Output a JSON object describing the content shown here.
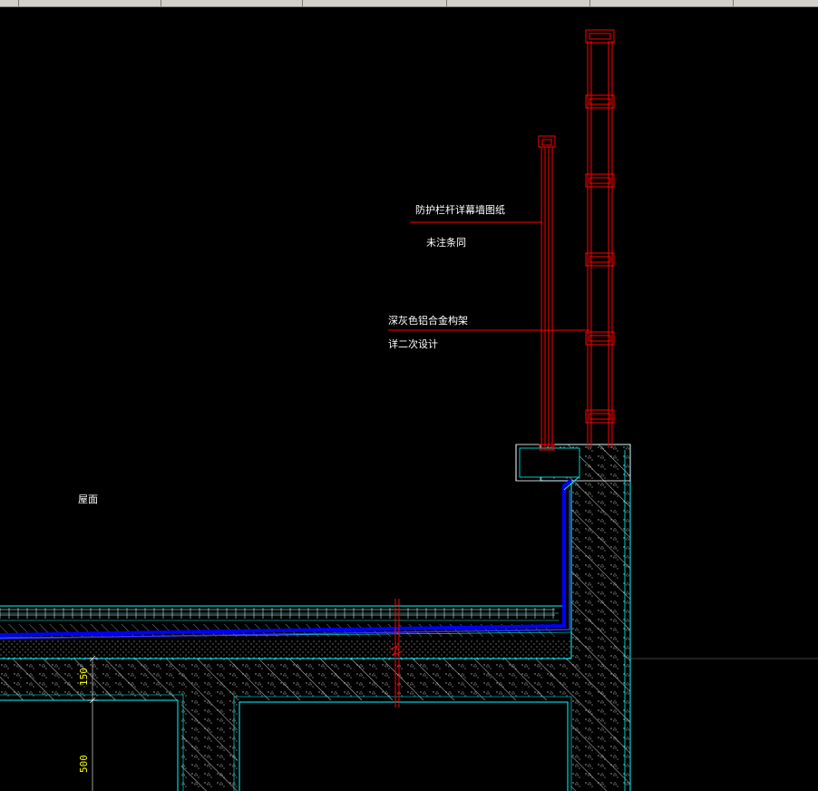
{
  "annotations": {
    "railing_note_1": "防护栏杆详幕墙图纸",
    "railing_note_2": "未注条同",
    "frame_note_1": "深灰色铝合金构架",
    "frame_note_2": "详二次设计",
    "roof_label": "屋面"
  },
  "dimensions": {
    "dim_150": "150",
    "dim_500": "500"
  },
  "colors": {
    "background": "#000000",
    "railing": "#ff0000",
    "structure": "#00ffff",
    "waterproof": "#0000ff",
    "hatch": "#ffffff",
    "dimension_text": "#ffff00"
  }
}
